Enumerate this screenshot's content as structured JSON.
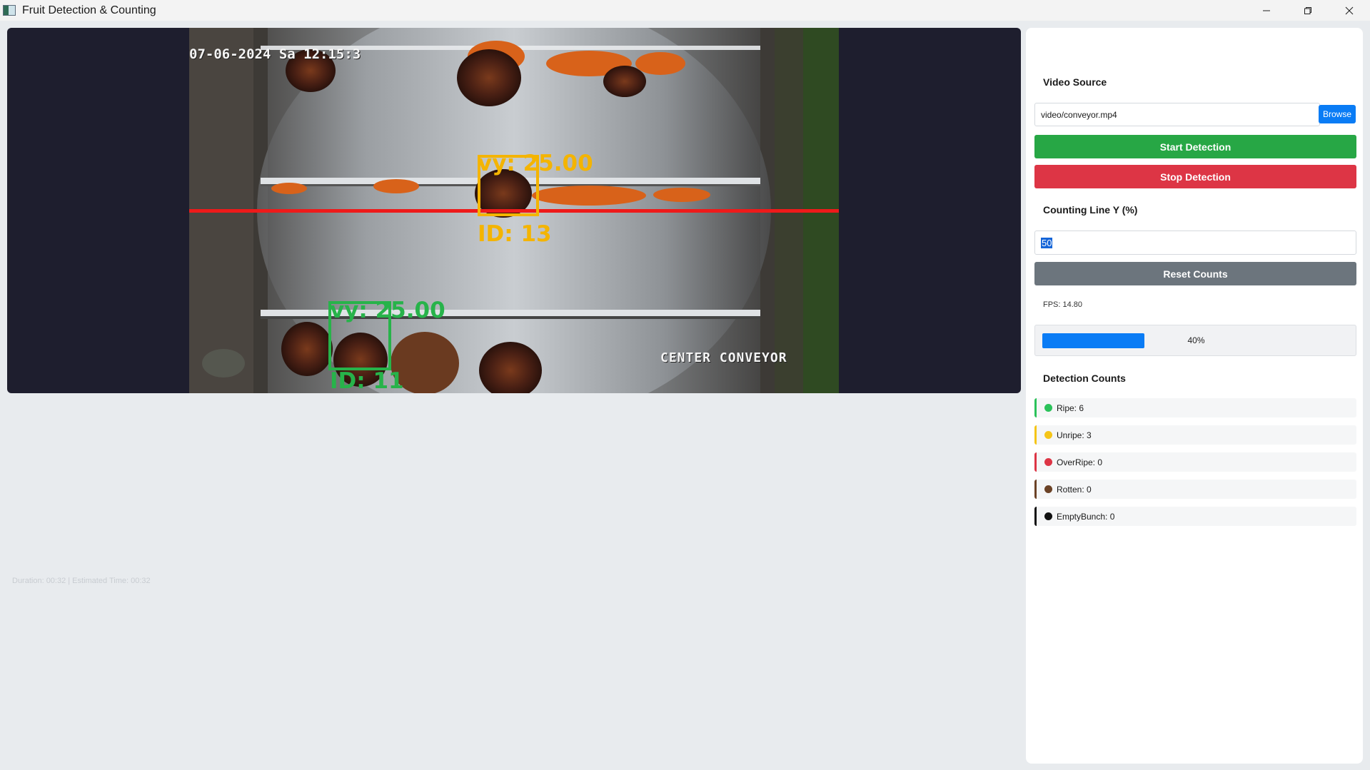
{
  "window": {
    "title": "Fruit Detection & Counting",
    "controls": [
      "minimize-icon",
      "restore-icon",
      "close-icon"
    ]
  },
  "video": {
    "timestamp_overlay": "07-06-2024 Sa 12:15:3",
    "camera_label": "CENTER CONVEYOR",
    "counting_line_color": "#ee1a1a",
    "tracks": [
      {
        "vy_label": "vy: 25.00",
        "id_label": "ID: 13",
        "color": "#f4b400"
      },
      {
        "vy_label": "vy: 25.00",
        "id_label": "ID: 11",
        "color": "#27b34a"
      }
    ]
  },
  "status": {
    "duration_text": "Duration: 00:32 | Estimated Time: 00:32"
  },
  "sidebar": {
    "video_source_title": "Video Source",
    "video_path": "video/conveyor.mp4",
    "browse_label": "Browse",
    "start_label": "Start Detection",
    "stop_label": "Stop Detection",
    "counting_line_title": "Counting Line Y (%)",
    "counting_line_value": "50",
    "reset_label": "Reset Counts",
    "fps_text": "FPS: 14.80",
    "progress": {
      "fraction": 0.4,
      "label": "40%"
    },
    "detection_counts_title": "Detection Counts",
    "counts": [
      {
        "label": "Ripe: 6",
        "color": "#2bc25a"
      },
      {
        "label": "Unripe: 3",
        "color": "#f5c518"
      },
      {
        "label": "OverRipe: 0",
        "color": "#dd3545"
      },
      {
        "label": "Rotten: 0",
        "color": "#6b4226"
      },
      {
        "label": "EmptyBunch: 0",
        "color": "#111111"
      }
    ]
  },
  "colors": {
    "accent_blue": "#0a7cf5",
    "start_green": "#27a745",
    "stop_red": "#dd3545",
    "reset_gray": "#6c757d"
  }
}
